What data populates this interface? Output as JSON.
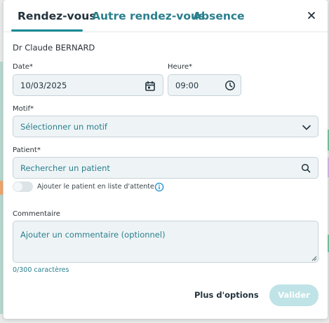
{
  "tabs": [
    {
      "label": "Rendez-vous",
      "active": true
    },
    {
      "label": "Autre rendez-vous",
      "active": false
    },
    {
      "label": "Absence",
      "active": false
    }
  ],
  "doctor_name": "Dr Claude BERNARD",
  "date": {
    "label": "Date*",
    "value": "10/03/2025"
  },
  "time": {
    "label": "Heure*",
    "value": "09:00"
  },
  "motif": {
    "label": "Motif*",
    "placeholder": "Sélectionner un motif"
  },
  "patient": {
    "label": "Patient*",
    "placeholder": "Rechercher un patient"
  },
  "waitlist": {
    "label": "Ajouter le patient en liste d'attente",
    "enabled": false
  },
  "comment": {
    "label": "Commentaire",
    "placeholder": "Ajouter un commentaire (optionnel)",
    "counter": "0/300 caractères"
  },
  "actions": {
    "more_options": "Plus d'options",
    "submit": "Valider"
  },
  "colors": {
    "accent": "#178a93",
    "link": "#2a7f8d",
    "submit_disabled": "#bfe3e6",
    "field_bg": "#eef4f6",
    "info": "#1f8fd0"
  },
  "icons": {
    "close": "close-icon",
    "calendar": "calendar-icon",
    "clock": "clock-icon",
    "chevron": "chevron-down-icon",
    "search": "search-icon",
    "info": "info-icon"
  }
}
